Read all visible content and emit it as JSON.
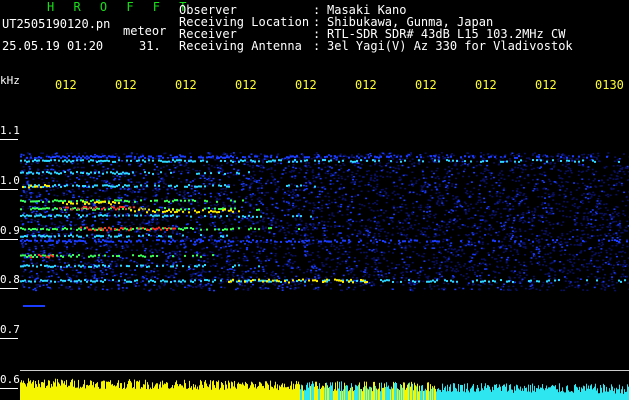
{
  "header": {
    "program_title": "H R O F F T",
    "file_name": "UT2505190120.pn",
    "meteor_label": "meteor",
    "datetime": "25.05.19 01:20",
    "meteor_count": "31."
  },
  "station": {
    "rows": [
      {
        "label": "Observer",
        "sep": ":",
        "value": "Masaki Kano"
      },
      {
        "label": "Receiving Location",
        "sep": ":",
        "value": "Shibukawa, Gunma, Japan"
      },
      {
        "label": "Receiver",
        "sep": ":",
        "value": "RTL-SDR SDR# 43dB L15 103.2MHz CW"
      },
      {
        "label": "Receiving Antenna",
        "sep": ":",
        "value": "3el Yagi(V) Az 330 for Vladivostok"
      }
    ]
  },
  "axes": {
    "y_unit": "kHz",
    "y_ticks": [
      "1.1",
      "1.0",
      "0.9",
      "0.8",
      "0.7",
      "0.6"
    ],
    "x_ticks": [
      "012",
      "012",
      "012",
      "012",
      "012",
      "012",
      "012",
      "012",
      "012",
      "0130"
    ]
  },
  "colors": {
    "background": "#000000",
    "text": "#ffffff",
    "title_green": "#19e019",
    "time_yellow": "#ffff33",
    "noise_low": "#0a1060",
    "noise_mid": "#1a3cff",
    "echo_cyan": "#2fd6ff",
    "echo_green": "#3cff5a",
    "echo_yellow": "#ffee00",
    "echo_red": "#ff3322",
    "level_yellow": "#f5f500",
    "level_cyan": "#2ee6f0"
  }
}
